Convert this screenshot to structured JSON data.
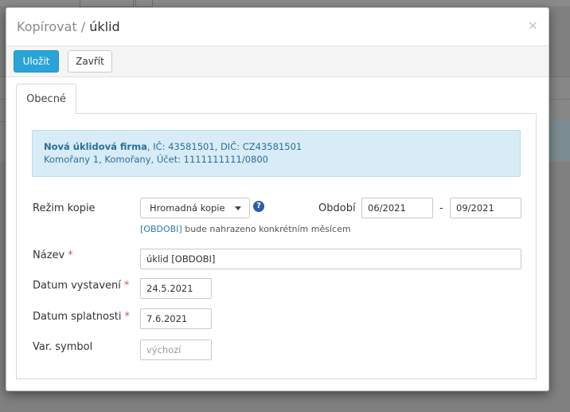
{
  "dialog": {
    "title_prefix": "Kopírovat",
    "title_separator": "/",
    "title_name": "úklid",
    "close_symbol": "×"
  },
  "toolbar": {
    "save_label": "Uložit",
    "close_label": "Zavřít"
  },
  "tabs": [
    {
      "label": "Obecné",
      "active": true
    }
  ],
  "info": {
    "company_name": "Nová úklidová firma",
    "company_details": ", IČ: 43581501, DIČ: CZ43581501",
    "address_line": "Komořany 1, Komořany, Účet: 1111111111/0800"
  },
  "form": {
    "copy_mode": {
      "label": "Režim kopie",
      "value": "Hromadná kopie",
      "help_symbol": "?"
    },
    "period": {
      "label": "Období",
      "from": "06/2021",
      "to": "09/2021",
      "separator": "-"
    },
    "hint": {
      "token": "[OBDOBI]",
      "text": " bude nahrazeno konkrétním měsícem"
    },
    "name": {
      "label": "Název",
      "value": "úklid [OBDOBI]",
      "required_mark": "*"
    },
    "issue_date": {
      "label": "Datum vystavení",
      "value": "24.5.2021",
      "required_mark": "*"
    },
    "due_date": {
      "label": "Datum splatnosti",
      "value": "7.6.2021",
      "required_mark": "*"
    },
    "var_symbol": {
      "label": "Var. symbol",
      "value": "",
      "placeholder": "výchozí"
    }
  },
  "colors": {
    "primary_button": "#2aa4d8",
    "info_background": "#d7ecf6",
    "info_text": "#2a6f97",
    "required": "#d9534f",
    "help_icon": "#2a5ea8"
  }
}
